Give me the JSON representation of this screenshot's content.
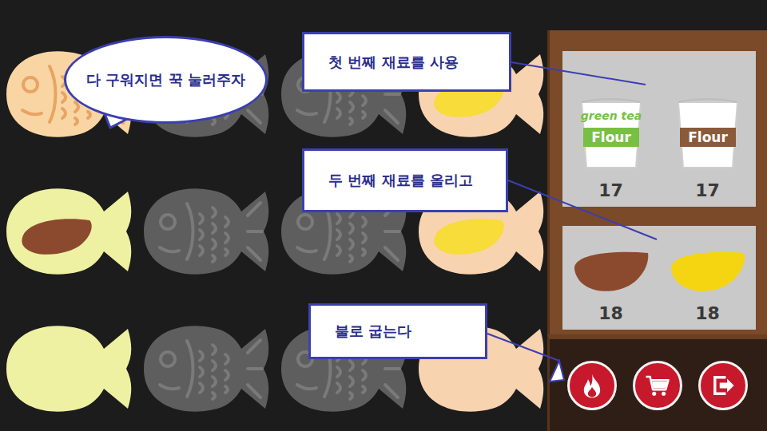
{
  "grill": {
    "rows": [
      [
        {
          "kind": "baked",
          "color": "#f9d5a3",
          "filling": null
        },
        {
          "kind": "mold",
          "color": "#5e5e5e",
          "filling": null
        },
        {
          "kind": "mold",
          "color": "#5e5e5e",
          "filling": null
        },
        {
          "kind": "batter",
          "color": "#f8d3b0",
          "filling": "#f7dc3a"
        }
      ],
      [
        {
          "kind": "batter",
          "color": "#eef0a2",
          "filling": "#8b4a2e"
        },
        {
          "kind": "mold",
          "color": "#5e5e5e",
          "filling": null
        },
        {
          "kind": "mold",
          "color": "#5e5e5e",
          "filling": null
        },
        {
          "kind": "batter",
          "color": "#f8d3b0",
          "filling": "#f7dc3a"
        }
      ],
      [
        {
          "kind": "batter",
          "color": "#eef0a2",
          "filling": null
        },
        {
          "kind": "mold",
          "color": "#5e5e5e",
          "filling": null
        },
        {
          "kind": "mold",
          "color": "#5e5e5e",
          "filling": null
        },
        {
          "kind": "batter",
          "color": "#f8d3b0",
          "filling": null
        }
      ]
    ]
  },
  "bubble": {
    "text": "다 구워지면 꾹 눌러주자"
  },
  "callouts": [
    {
      "text": "첫 번째 재료를 사용"
    },
    {
      "text": "두 번째 재료를 올리고"
    },
    {
      "text": "불로 굽는다"
    }
  ],
  "shelves": [
    {
      "items": [
        {
          "kind": "bag",
          "label": "Flour",
          "sublabel": "green tea",
          "count": "17",
          "color": "#77c043"
        },
        {
          "kind": "bag",
          "label": "Flour",
          "count": "17",
          "color": "#8a5a3b"
        }
      ]
    },
    {
      "items": [
        {
          "kind": "filling",
          "count": "18",
          "color": "#8b4a2e"
        },
        {
          "kind": "filling",
          "count": "18",
          "color": "#f5d512"
        }
      ]
    }
  ]
}
